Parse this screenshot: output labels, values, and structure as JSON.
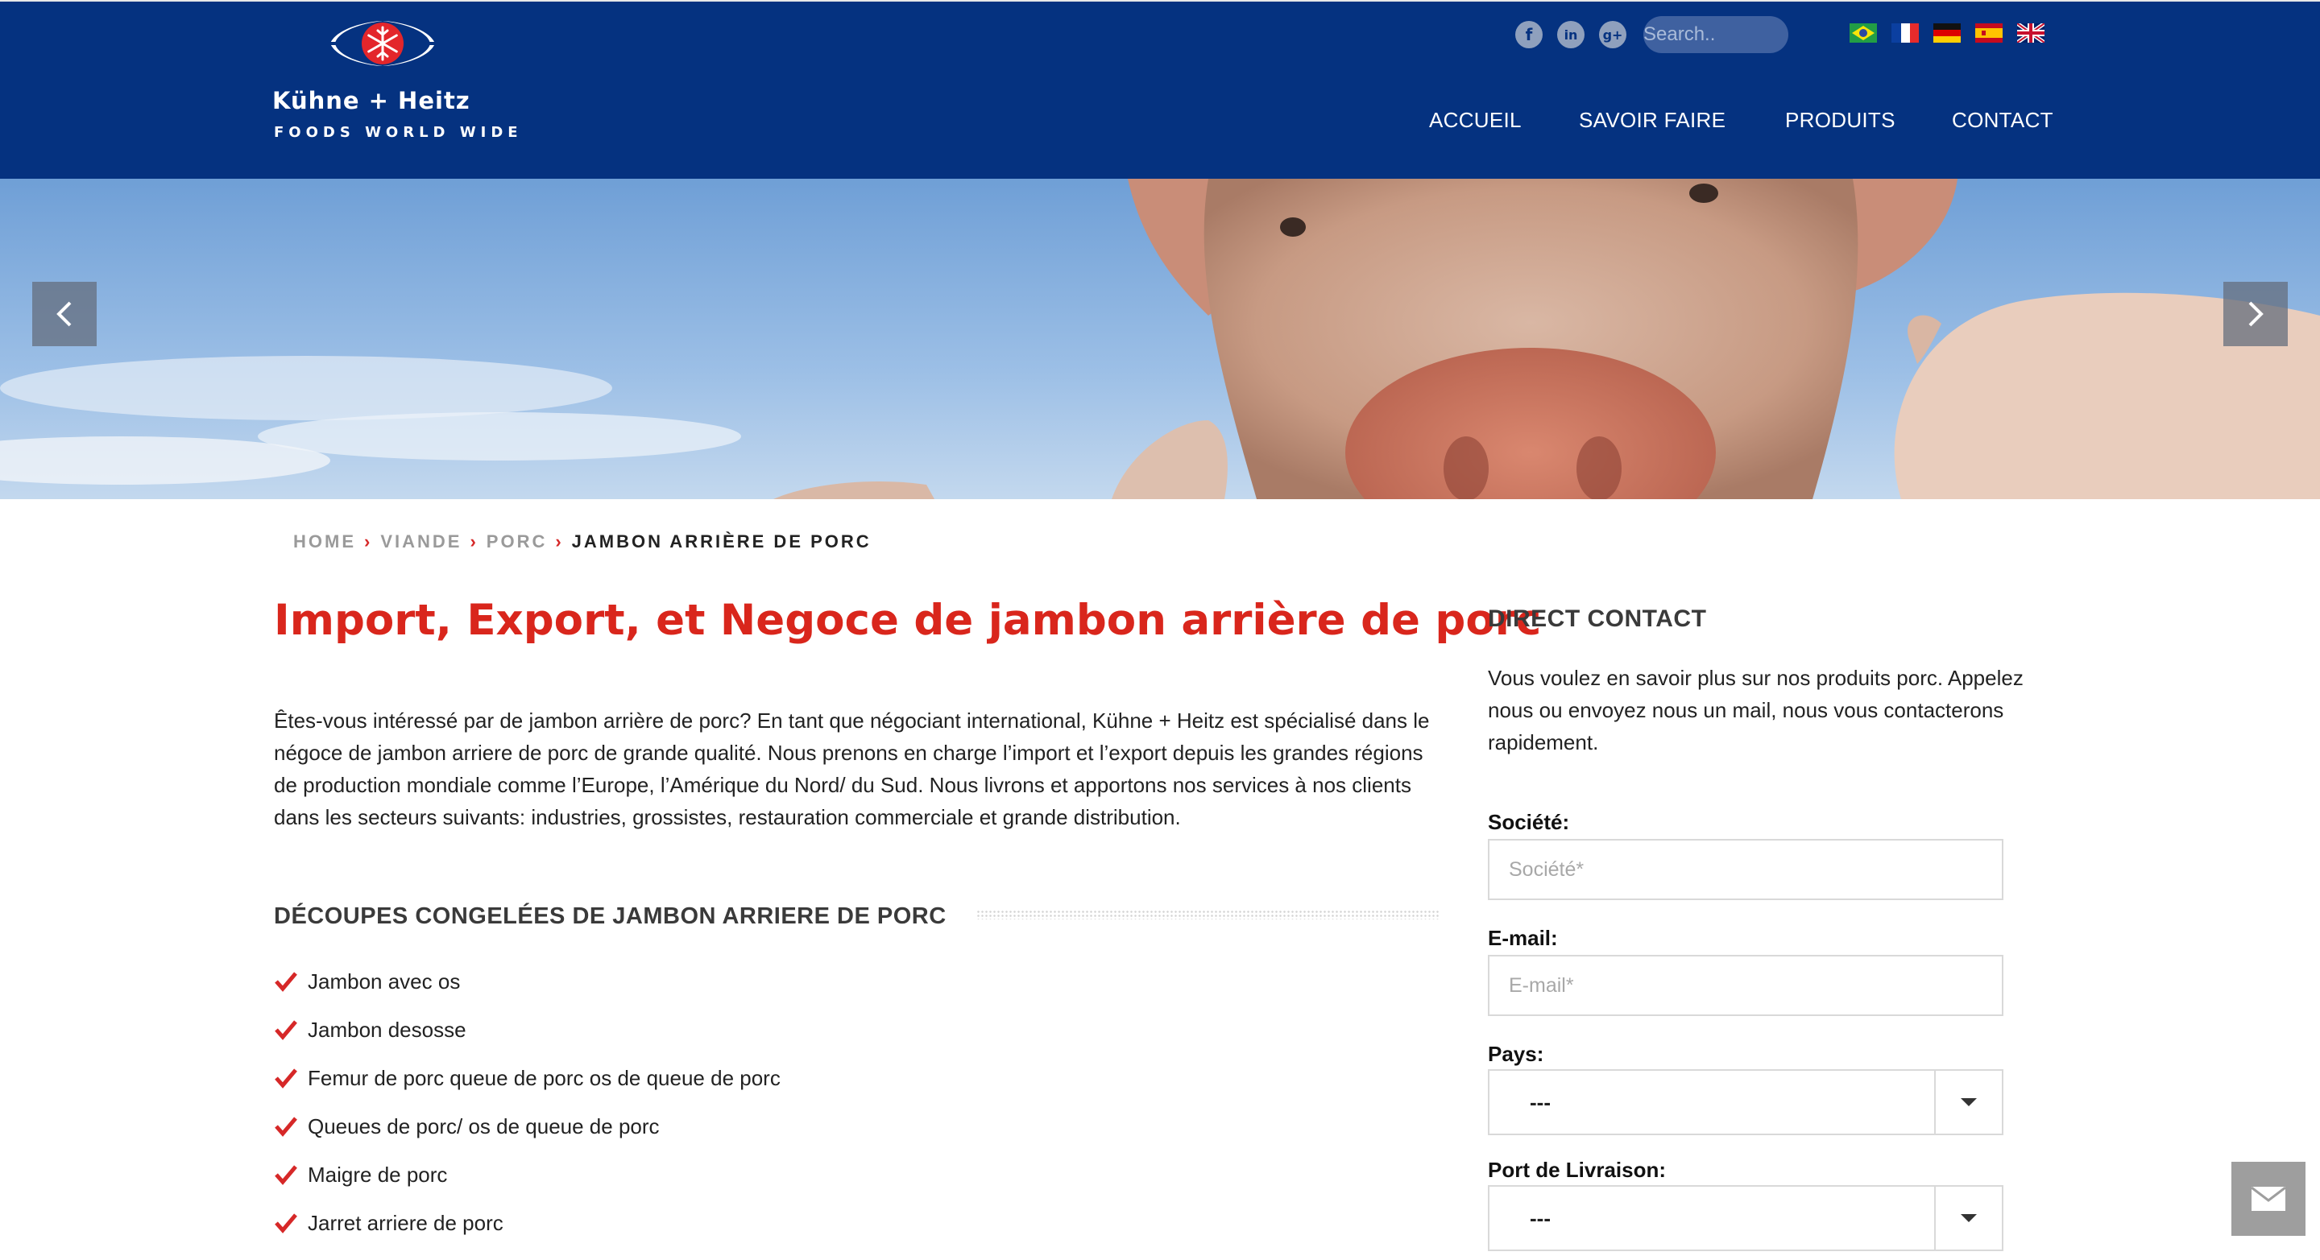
{
  "brand": {
    "name": "Kühne + Heitz",
    "tagline": "FOODS WORLD WIDE"
  },
  "header": {
    "social": [
      {
        "icon": "facebook-icon",
        "glyph": "f"
      },
      {
        "icon": "linkedin-icon",
        "glyph": "in"
      },
      {
        "icon": "google-plus-icon",
        "glyph": "g+"
      }
    ],
    "search_placeholder": "Search..",
    "languages": [
      "brazil-flag-icon",
      "france-flag-icon",
      "germany-flag-icon",
      "spain-flag-icon",
      "uk-flag-icon"
    ],
    "nav": [
      "ACCUEIL",
      "SAVOIR FAIRE",
      "PRODUITS",
      "CONTACT"
    ]
  },
  "breadcrumb": {
    "items": [
      "HOME",
      "VIANDE",
      "PORC"
    ],
    "current": "JAMBON ARRIÈRE DE PORC",
    "separator": "›"
  },
  "main": {
    "title": "Import, Export, et Negoce de jambon arrière de porc",
    "intro": "Êtes-vous intéressé  par de jambon arrière de porc? En tant que négociant international, Kühne + Heitz est spécialisé dans le négoce de jambon arriere de porc de grande qualité. Nous prenons en charge l’import et l’export depuis les grandes régions de production mondiale comme l’Europe, l’Amérique du Nord/ du Sud. Nous livrons et apportons nos services à nos clients dans les secteurs suivants: industries, grossistes, restauration commerciale et grande distribution.",
    "section_title": "DÉCOUPES CONGELÉES DE JAMBON ARRIERE DE PORC",
    "items": [
      "Jambon avec os",
      "Jambon desosse",
      "Femur de porc queue de porc os de queue de porc",
      "Queues de porc/ os de queue de porc",
      "Maigre de porc",
      "Jarret arriere de porc"
    ]
  },
  "sidebar": {
    "title": "DIRECT CONTACT",
    "text": "Vous voulez en savoir plus sur nos produits porc. Appelez nous ou envoyez nous un mail, nous vous contacterons rapidement.",
    "fields": {
      "company_label": "Société:",
      "company_placeholder": "Société*",
      "email_label": "E-mail:",
      "email_placeholder": "E-mail*",
      "country_label": "Pays:",
      "country_value": "---",
      "port_label": "Port de Livraison:",
      "port_value": "---"
    }
  },
  "colors": {
    "header_bg": "#053280",
    "accent_red": "#d9261c",
    "text": "#222222"
  }
}
